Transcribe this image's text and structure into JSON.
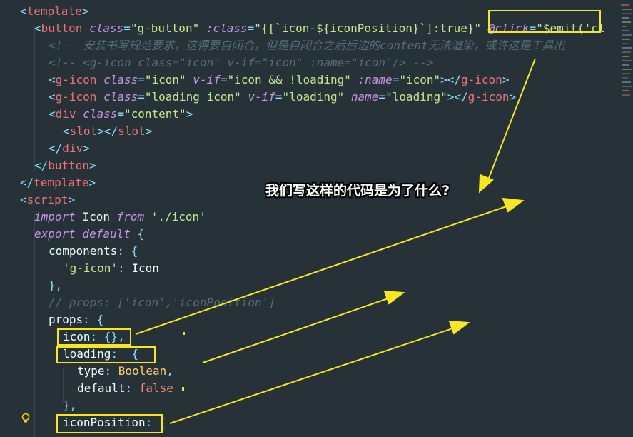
{
  "annotation": {
    "question": "我们写这样的代码是为了什么?"
  },
  "code": {
    "l1": {
      "a": "<",
      "b": "template",
      "c": ">"
    },
    "l2": {
      "a": "<",
      "b": "button",
      "c": " class",
      "d": "=",
      "e": "\"g-button\"",
      "f": " :class",
      "g": "=",
      "h": "\"{[`icon-${iconPosition}`]:true}\"",
      "i": " @click",
      "j": "=",
      "k": "\"$emit('cl"
    },
    "l3": {
      "a": "<!-- 安装书写规范要求，这得要自闭合，但是自闭合之后后边的content无法渲染，或许这是工具出"
    },
    "l4": {
      "a": "<!-- <g-icon class=\"icon\" v-if=\"icon\" :name=\"icon\"/> -->"
    },
    "l5": {
      "a": "<",
      "b": "g-icon",
      "c": " class",
      "d": "=",
      "e": "\"icon\"",
      "f": " v-if",
      "g": "=",
      "h": "\"icon && !loading\"",
      "i": " :name",
      "j": "=",
      "k": "\"icon\"",
      "l": "></",
      "m": "g-icon",
      "n": ">"
    },
    "l6": {
      "a": "<",
      "b": "g-icon",
      "c": " class",
      "d": "=",
      "e": "\"loading icon\"",
      "f": " v-if",
      "g": "=",
      "h": "\"loading\"",
      "i": " name",
      "j": "=",
      "k": "\"loading\"",
      "l": "></",
      "m": "g-icon",
      "n": ">"
    },
    "l7": {
      "a": "<",
      "b": "div",
      "c": " class",
      "d": "=",
      "e": "\"content\"",
      "f": ">"
    },
    "l8": {
      "a": "<",
      "b": "slot",
      "c": "></",
      "d": "slot",
      "e": ">"
    },
    "l9": {
      "a": "</",
      "b": "div",
      "c": ">"
    },
    "l10": {
      "a": "</",
      "b": "button",
      "c": ">"
    },
    "l11": {
      "a": "</",
      "b": "template",
      "c": ">"
    },
    "l12": {
      "a": "<",
      "b": "script",
      "c": ">"
    },
    "l13": {
      "a": "import",
      "b": " Icon ",
      "c": "from",
      "d": " './icon'"
    },
    "l14": {
      "a": "export",
      "b": " default",
      "c": " {"
    },
    "l15": {
      "a": "components",
      "b": ": {"
    },
    "l16": {
      "a": "'g-icon'",
      "b": ": ",
      "c": "Icon"
    },
    "l17": {
      "a": "},"
    },
    "l18": {
      "a": "// props: ['icon','iconPosition']"
    },
    "l19": {
      "a": "props",
      "b": ": {"
    },
    "l20": {
      "a": "icon",
      "b": ": {},",
      "c": ""
    },
    "l21": {
      "a": "loading",
      "b": ":  {"
    },
    "l22": {
      "a": "type",
      "b": ": ",
      "c": "Boolean",
      "d": ","
    },
    "l23": {
      "a": "default",
      "b": ": ",
      "c": "false"
    },
    "l24": {
      "a": "},"
    },
    "l25": {
      "a": "iconPosition",
      "b": ": {"
    }
  },
  "colors": {
    "background": "#263238",
    "annotation": "#f8e71c"
  },
  "icons": {
    "gutter": "lightbulb-icon"
  }
}
